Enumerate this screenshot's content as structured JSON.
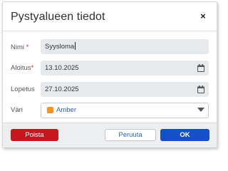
{
  "dialog": {
    "title": "Pystyalueen tiedot",
    "close_glyph": "×"
  },
  "form": {
    "name": {
      "label": "Nimi",
      "required_mark": "*",
      "value": "Syysloma"
    },
    "start": {
      "label": "Aloitus",
      "required_mark": "*",
      "value": "13.10.2025",
      "icon": "calendar-icon"
    },
    "end": {
      "label": "Lopetus",
      "value": "27.10.2025",
      "icon": "calendar-icon"
    },
    "color": {
      "label": "Väri",
      "value": "Amber",
      "swatch_color": "#f5941f",
      "icon": "chevron-down-icon"
    }
  },
  "buttons": {
    "delete": "Poista",
    "cancel": "Peruuta",
    "ok": "OK"
  },
  "colors": {
    "delete": "#c8161e",
    "ok": "#1550c8",
    "link": "#2c66c0",
    "required": "#d0282e"
  }
}
